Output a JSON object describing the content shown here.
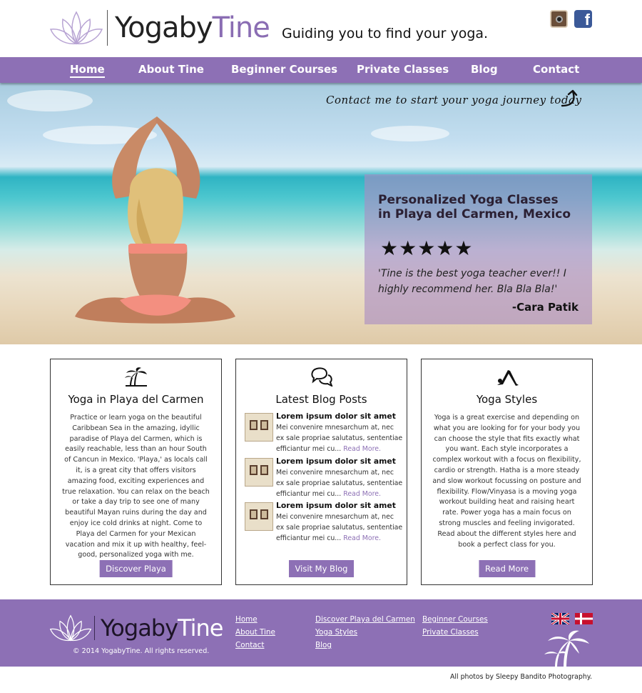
{
  "brand": {
    "name_part1": "Yogaby",
    "name_part2": "Tine",
    "tagline": "Guiding you to find your yoga.",
    "accent_color": "#8d70b5"
  },
  "social": [
    {
      "icon": "instagram-icon"
    },
    {
      "icon": "facebook-icon"
    }
  ],
  "nav": {
    "items": [
      {
        "label": "Home",
        "active": true
      },
      {
        "label": "About Tine",
        "active": false
      },
      {
        "label": "Beginner Courses",
        "active": false
      },
      {
        "label": "Private Classes",
        "active": false
      },
      {
        "label": "Blog",
        "active": false
      },
      {
        "label": "Contact",
        "active": false
      }
    ]
  },
  "hero": {
    "cta": "Contact me to start your yoga journey today",
    "title_line1": "Personalized Yoga Classes",
    "title_line2": "in Playa del Carmen, Mexico",
    "rating": 5,
    "stars": "★★★★★",
    "quote": "'Tine is the best yoga teacher ever!! I highly recommend her. Bla Bla Bla!'",
    "author": "-Cara Patik"
  },
  "boxes": {
    "playa": {
      "icon": "palm-trees-icon",
      "title": "Yoga in Playa del Carmen",
      "text": "Practice or learn yoga on the beautiful Caribbean Sea in the amazing, idyllic paradise of Playa del Carmen, which is easily reachable, less than an hour South of Cancun in Mexico. 'Playa,' as locals call it, is a great city that offers visitors amazing food, exciting experiences and true relaxation. You can relax on the beach or take a day trip to see one of many beautiful Mayan ruins during the day and enjoy ice cold drinks at night. Come to Playa del Carmen for your Mexican vacation and mix it up with healthy, feel-good, personalized yoga with me.",
      "button": "Discover Playa"
    },
    "blog": {
      "icon": "speech-bubbles-icon",
      "title": "Latest Blog Posts",
      "posts": [
        {
          "title": "Lorem ipsum dolor sit amet",
          "excerpt": "Mei convenire mnesarchum at, nec ex sale propriae salutatus, sententiae efficiantur mei cu...",
          "more": "Read More."
        },
        {
          "title": "Lorem ipsum dolor sit amet",
          "excerpt": "Mei convenire mnesarchum at, nec ex sale propriae salutatus, sententiae efficiantur mei cu...",
          "more": "Read More."
        },
        {
          "title": "Lorem ipsum dolor sit amet",
          "excerpt": "Mei convenire mnesarchum at, nec ex sale propriae salutatus, sententiae efficiantur mei cu...",
          "more": "Read More."
        }
      ],
      "button": "Visit My Blog"
    },
    "styles": {
      "icon": "yoga-pose-icon",
      "title": "Yoga Styles",
      "text": "Yoga is a great exercise and depending on what you are looking for for your body you can choose the style that fits exactly what you want. Each style incorporates a complex workout with a focus on flexibility, cardio or strength. Hatha is a more steady and slow workout focussing on posture and flexibility. Flow/Vinyasa is a moving yoga workout building heat and raising heart rate. Power yoga has a main focus on strong muscles and feeling invigorated. Read about the different styles here and book a perfect class for you.",
      "button": "Read More"
    }
  },
  "footer": {
    "copyright": "© 2014 YogabyTine. All rights reserved.",
    "col1": [
      "Home",
      "About Tine",
      "Contact"
    ],
    "col2": [
      "Discover Playa del Carmen",
      "Yoga Styles",
      "Blog"
    ],
    "col3": [
      "Beginner Courses",
      "Private Classes"
    ],
    "languages": [
      {
        "icon": "uk-flag-icon"
      },
      {
        "icon": "denmark-flag-icon"
      }
    ]
  },
  "credit": "All photos by Sleepy Bandito Photography."
}
